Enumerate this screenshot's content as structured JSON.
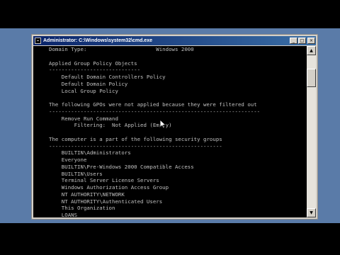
{
  "window": {
    "title": "Administrator: C:\\Windows\\system32\\cmd.exe",
    "minimize_glyph": "_",
    "maximize_glyph": "□",
    "close_glyph": "×"
  },
  "console": {
    "lines": [
      "Domain Type:                      Windows 2000",
      "",
      "Applied Group Policy Objects",
      "-----------------------------",
      "    Default Domain Controllers Policy",
      "    Default Domain Policy",
      "    Local Group Policy",
      "",
      "The following GPOs were not applied because they were filtered out",
      "-------------------------------------------------------------------",
      "    Remove Run Command",
      "        Filtering:  Not Applied (Empty)",
      "",
      "The computer is a part of the following security groups",
      "-------------------------------------------------------",
      "    BUILTIN\\Administrators",
      "    Everyone",
      "    BUILTIN\\Pre-Windows 2000 Compatible Access",
      "    BUILTIN\\Users",
      "    Terminal Server License Servers",
      "    Windows Authorization Access Group",
      "    NT AUTHORITY\\NETWORK",
      "    NT AUTHORITY\\Authenticated Users",
      "    This Organization",
      "    LOANS"
    ]
  },
  "scrollbar": {
    "up_glyph": "▲",
    "down_glyph": "▼"
  },
  "colors": {
    "console_bg": "#000000",
    "console_text": "#c0c0c0",
    "titlebar_start": "#0a246a",
    "titlebar_end": "#3a6ea5",
    "desktop": "#5a7ba8"
  }
}
